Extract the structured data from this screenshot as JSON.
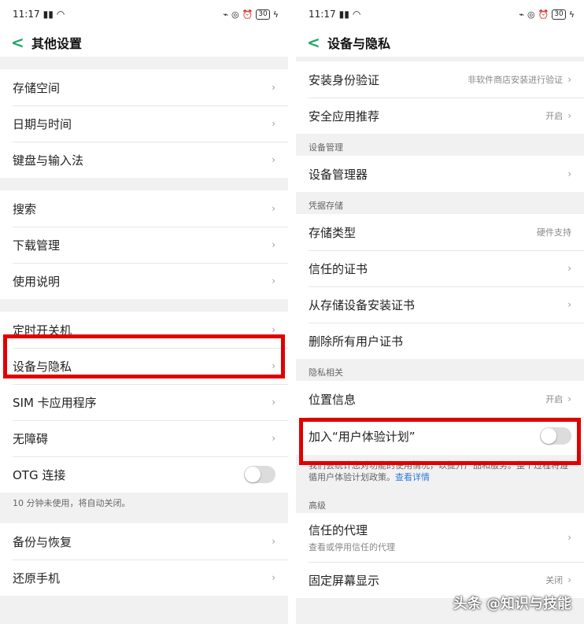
{
  "status": {
    "time": "11:17",
    "battery": "30"
  },
  "left": {
    "title": "其他设置",
    "group1": [
      "存储空间",
      "日期与时间",
      "键盘与输入法"
    ],
    "group2": [
      "搜索",
      "下载管理",
      "使用说明"
    ],
    "group3": [
      "定时开关机",
      "设备与隐私",
      "SIM 卡应用程序",
      "无障碍",
      "OTG 连接"
    ],
    "otg_note": "10 分钟未使用，将自动关闭。",
    "group4": [
      "备份与恢复",
      "还原手机"
    ]
  },
  "right": {
    "title": "设备与隐私",
    "install_verify": {
      "label": "安装身份验证",
      "value": "非软件商店安装进行验证"
    },
    "safe_recommend": {
      "label": "安全应用推荐",
      "value": "开启"
    },
    "section_device": "设备管理",
    "device_admin": "设备管理器",
    "section_credential": "凭据存储",
    "storage_type": {
      "label": "存储类型",
      "value": "硬件支持"
    },
    "trusted_cert": "信任的证书",
    "install_from_storage": "从存储设备安装证书",
    "remove_certs": "删除所有用户证书",
    "section_privacy": "隐私相关",
    "location": {
      "label": "位置信息",
      "value": "开启"
    },
    "ux_plan": "加入“用户体验计划”",
    "ux_note": "我们会统计您对功能的使用情况，以提升产品和服务。整个过程将遵循用户体验计划政策。",
    "ux_link": "查看详情",
    "section_advanced": "高级",
    "trust_agent": {
      "label": "信任的代理",
      "sub": "查看或停用信任的代理"
    },
    "screen_pin": {
      "label": "固定屏幕显示",
      "value": "关闭"
    }
  },
  "watermark": "头条 @知识与技能",
  "colors": {
    "accent": "#1fa865",
    "highlight": "#e10000",
    "link": "#2f7bd6"
  }
}
